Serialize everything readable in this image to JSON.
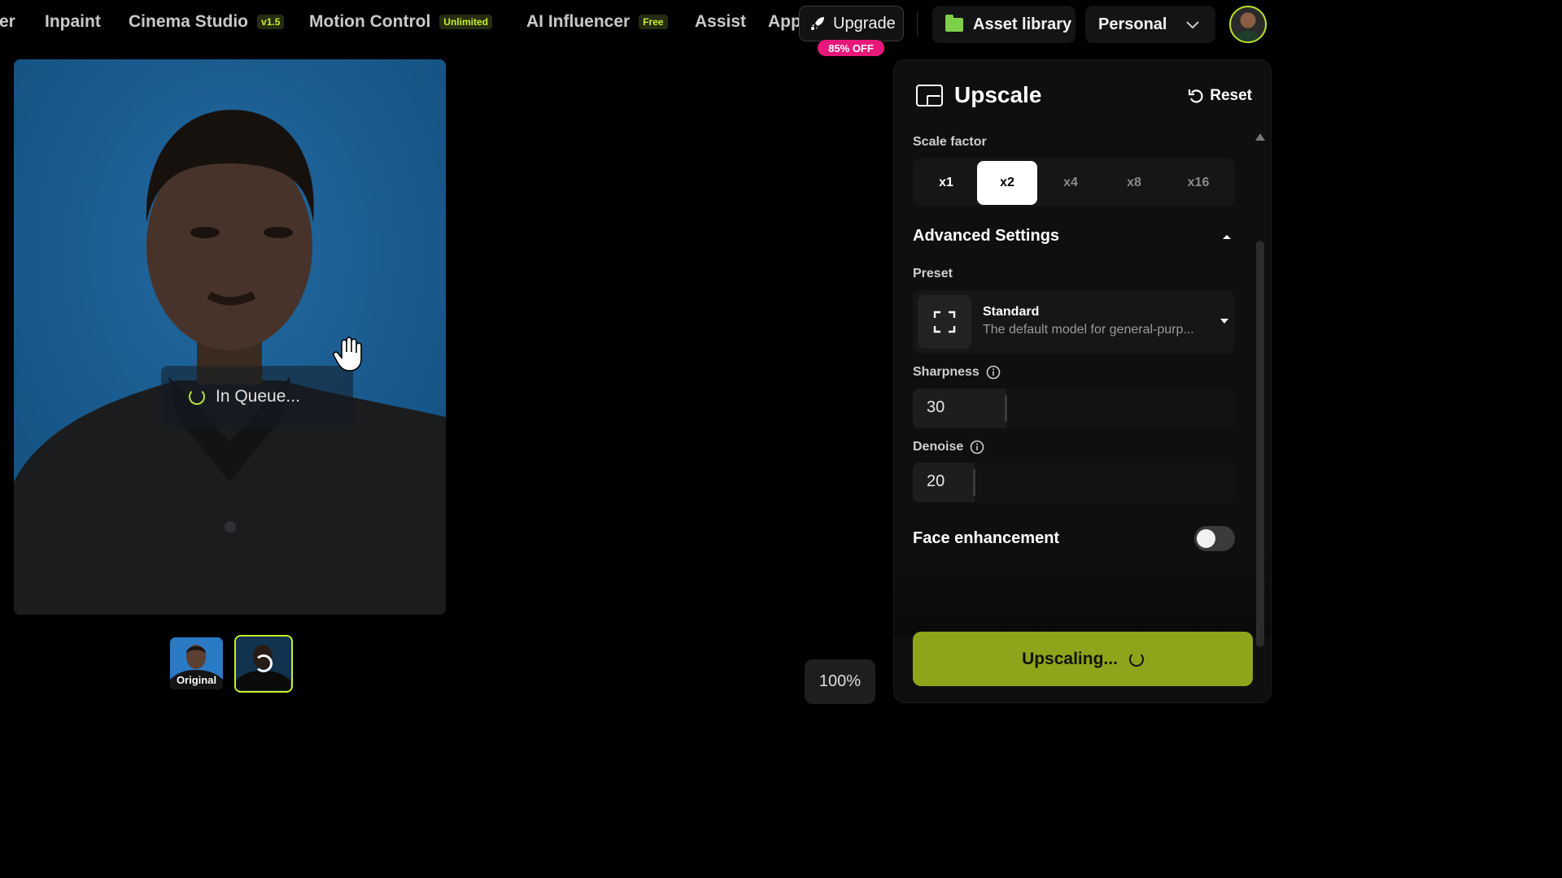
{
  "nav": {
    "items": [
      {
        "label": "er",
        "badge": ""
      },
      {
        "label": "Inpaint",
        "badge": ""
      },
      {
        "label": "Cinema Studio",
        "badge": "v1.5"
      },
      {
        "label": "Motion Control",
        "badge": "Unlimited"
      },
      {
        "label": "AI Influencer",
        "badge": "Free"
      },
      {
        "label": "Assist",
        "badge": ""
      },
      {
        "label": "App",
        "badge": ""
      }
    ],
    "upgrade_label": "Upgrade",
    "discount_badge": "85% OFF",
    "asset_library_label": "Asset library",
    "workspace_label": "Personal"
  },
  "preview": {
    "status_text": "In Queue...",
    "original_thumb_label": "Original",
    "zoom_level": "100%"
  },
  "panel": {
    "title": "Upscale",
    "reset_label": "Reset",
    "scale_factor_label": "Scale factor",
    "scale_options": [
      "x1",
      "x2",
      "x4",
      "x8",
      "x16"
    ],
    "scale_selected": "x2",
    "advanced_label": "Advanced Settings",
    "preset_label": "Preset",
    "preset_name": "Standard",
    "preset_description": "The default model for general-purp...",
    "sharpness_label": "Sharpness",
    "sharpness_value": "30",
    "denoise_label": "Denoise",
    "denoise_value": "20",
    "face_enhancement_label": "Face enhancement",
    "face_enhancement_on": false,
    "action_label": "Upscaling..."
  },
  "colors": {
    "accent": "#c7f02c",
    "action_button": "#8fa41a",
    "discount": "#e8187a",
    "preview_bg": "#1a5f95"
  },
  "icons": [
    "rocket-icon",
    "folder-icon",
    "chevron-down-icon",
    "upscale-icon",
    "reset-icon",
    "info-icon",
    "expand-icon",
    "caret-down-icon",
    "spinner-icon",
    "hand-cursor-icon"
  ]
}
